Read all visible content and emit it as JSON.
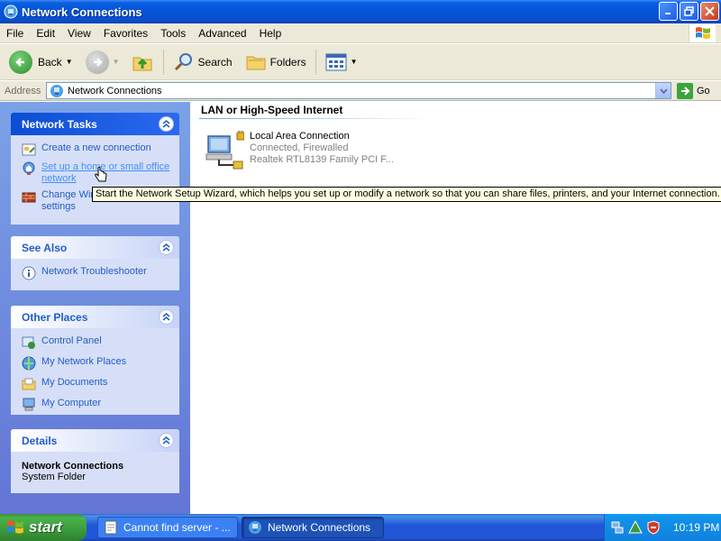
{
  "window": {
    "title": "Network Connections",
    "controls": [
      "minimize",
      "maximize",
      "close"
    ]
  },
  "menu": {
    "items": [
      "File",
      "Edit",
      "View",
      "Favorites",
      "Tools",
      "Advanced",
      "Help"
    ]
  },
  "toolbar": {
    "back_label": "Back",
    "search_label": "Search",
    "folders_label": "Folders"
  },
  "address": {
    "label": "Address",
    "value": "Network Connections",
    "go_label": "Go"
  },
  "left_pane": {
    "network_tasks": {
      "title": "Network Tasks",
      "items": [
        {
          "label": "Create a new connection",
          "icon": "new-connection-icon"
        },
        {
          "label": "Set up a home or small office network",
          "icon": "home-network-icon"
        },
        {
          "label": "Change Windows Firewall settings",
          "icon": "firewall-icon"
        }
      ]
    },
    "see_also": {
      "title": "See Also",
      "items": [
        {
          "label": "Network Troubleshooter",
          "icon": "info-icon"
        }
      ]
    },
    "other_places": {
      "title": "Other Places",
      "items": [
        {
          "label": "Control Panel",
          "icon": "control-panel-icon"
        },
        {
          "label": "My Network Places",
          "icon": "network-places-icon"
        },
        {
          "label": "My Documents",
          "icon": "documents-icon"
        },
        {
          "label": "My Computer",
          "icon": "computer-icon"
        }
      ]
    },
    "details": {
      "title": "Details",
      "name": "Network Connections",
      "type": "System Folder"
    }
  },
  "main": {
    "group_title": "LAN or High-Speed Internet",
    "connection": {
      "name": "Local Area Connection",
      "status": "Connected, Firewalled",
      "device": "Realtek RTL8139 Family PCI F..."
    }
  },
  "tooltip": {
    "text": "Start the Network Setup Wizard, which helps you set up or modify a network so that you can share files, printers, and your Internet connection."
  },
  "taskbar": {
    "start_label": "start",
    "tasks": [
      {
        "label": "Cannot find server - ...",
        "active": false
      },
      {
        "label": "Network Connections",
        "active": true
      }
    ],
    "clock": "10:19 PM"
  },
  "colors": {
    "titlebar": "#0553d6",
    "task_link": "#215dc6",
    "left_pane": "#6d8de0",
    "tooltip_bg": "#ffffe1"
  }
}
